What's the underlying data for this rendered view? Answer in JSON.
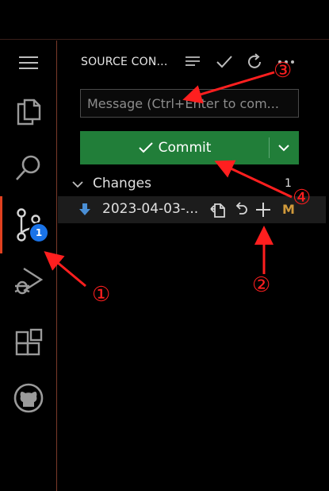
{
  "panel": {
    "title": "SOURCE CON...",
    "message_placeholder": "Message (Ctrl+Enter to com...",
    "commit_label": "Commit",
    "changes_label": "Changes",
    "changes_count": "1",
    "file_name": "2023-04-03-...",
    "file_status": "M"
  },
  "activity": {
    "badge": "1"
  },
  "annotations": {
    "n1": "①",
    "n2": "②",
    "n3": "③",
    "n4": "④"
  },
  "colors": {
    "accent_active": "#e0401f",
    "badge": "#1a73e8",
    "commit_green": "#217e39",
    "modified": "#d19a3b",
    "annotation_red": "#ff1f1f"
  },
  "icons": {
    "activity": [
      "menu-icon",
      "explorer-icon",
      "search-icon",
      "source-control-icon",
      "run-debug-icon",
      "extensions-icon",
      "github-icon"
    ],
    "header": [
      "view-as-tree-icon",
      "commit-check-icon",
      "refresh-icon",
      "more-actions-icon"
    ],
    "file_row": [
      "file-type-icon",
      "open-file-icon",
      "discard-changes-icon",
      "stage-changes-icon"
    ]
  }
}
